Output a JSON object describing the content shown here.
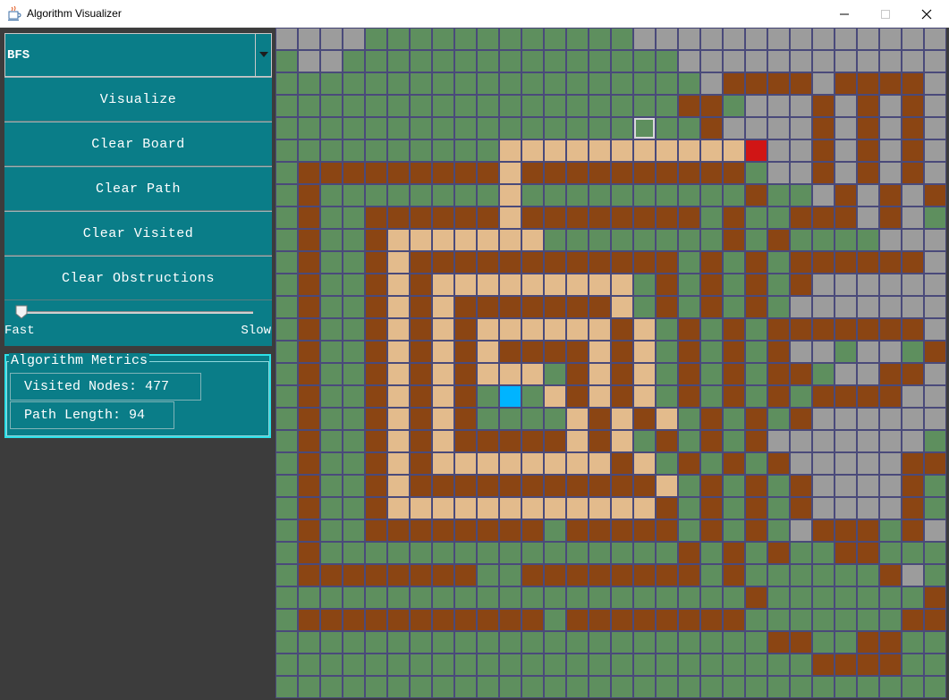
{
  "window": {
    "title": "Algorithm Visualizer",
    "icon": "java-coffee-icon"
  },
  "sidebar": {
    "algorithm_selected": "BFS",
    "buttons": {
      "visualize": "Visualize",
      "clear_board": "Clear Board",
      "clear_path": "Clear Path",
      "clear_visited": "Clear Visited",
      "clear_obstructions": "Clear Obstructions"
    },
    "speed": {
      "min_label": "Fast",
      "max_label": "Slow",
      "value": 0.0
    },
    "metrics": {
      "title": "Algorithm Metrics",
      "visited_nodes": "Visited Nodes: 477",
      "path_length": "Path Length: 94"
    }
  },
  "grid": {
    "rows": 30,
    "cols": 30,
    "legend": {
      "g": "unvisited",
      "v": "visited",
      "w": "wall",
      "p": "path",
      "s": "start",
      "e": "end",
      "h": "hover"
    },
    "colors": {
      "g": "#5e8f5e",
      "v": "#9c9c9c",
      "w": "#8b4513",
      "p": "#e3bb8c",
      "s": "#00b4ff",
      "e": "#d01515"
    },
    "cells": [
      "vvvvggggggggggggvvvvvvvvvvvvvv",
      "gvvgggggggggggggggvvvvvvvvvvvv",
      "gggggggggggggggggggvwwwwvwwwwv",
      "ggggggggggggggggggwwgvvvwvwvwv",
      "gggggggggggggggghggwvvvvwvwvwv",
      "ggggggggggpppppppppppevvwvwvwv",
      "gwwwwwwwwwpwwwwwwwwwwgvvwvwvwv",
      "gwggggggggpggggggggggwggvwvwvwv",
      "gwggwwwwwwpwwwwwwwwgwggwwwvwv",
      "gwggwpppppppggggggggwgwggggvvvvwv",
      "gwggwpwwwwwwwwwwwwgwgwgwwwwwwv",
      "gwggwpwpppppppppgwgwgwgwvvvvvv",
      "gwggwpwpwwwwwwwpgwgwgwgvvvvvvv",
      "gwggwpwpwppppppwpgwgwgwwwwwwwv",
      "gwggwpwpwpwwwwpwpgwgwgwvvgvvgwv",
      "gwggwpwpwpppgwpwpgwgwgwwgvvwwv",
      "gwggwpwpwgsgpwpwpgwgwgwgwwwwvv",
      "gwggwpwpwggggpwpwpgwgwgwvvvvvvv",
      "gwggwpwpwwwwwpwpgwgwgwvvvvvvv",
      "gwggwpwppppppppwpgwgwgwvvvvvwwv",
      "gwggwpwwwwwwwwwwwpgwgwgwvvvvwgwv",
      "gwggwppppppppppppwgwgwgwvvvvwgwv",
      "gwggwwwwwwwwgwwwwwgwgwgvwwwgwv",
      "gwggggggggggggggggwgwgwggwwgggwv",
      "gwwwwwwwwggwwwwwwwwgwggggggwv",
      "gggggggggggggggggggggwgggggggwv",
      "gwwwwwwwwwwwgwwwwwwwwgggggggwwv",
      "ggggggggggggggggggggggwwggwwgggv",
      "ggggggggggggggggggggggggwwwwgggv",
      "gggggggggggggggggggggggggggggggg"
    ]
  }
}
